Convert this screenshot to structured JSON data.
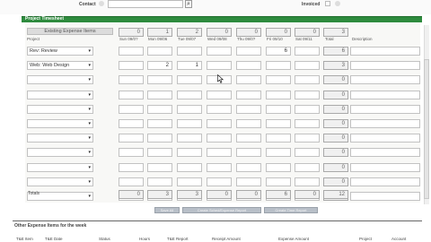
{
  "contact": {
    "label": "Contact",
    "value": ""
  },
  "invoiced": {
    "label": "Invoiced"
  },
  "section": {
    "title": "Project Timesheet"
  },
  "table": {
    "existing_label": "Existing Expense Items",
    "project_header": "Project",
    "day_headers": [
      "Sun 09/0?",
      "Mon 09/06",
      "Tue 09/07",
      "Wed 09/08",
      "Thu 09/0?",
      "Fri 09/10",
      "Sat 09/11"
    ],
    "total_header": "Total",
    "description_header": "Description",
    "existing_cells": [
      "0",
      "1",
      "2",
      "0",
      "0",
      "0",
      "0",
      "3"
    ],
    "rows": [
      {
        "project": "Rev: Review",
        "cells": [
          "",
          "",
          "",
          "",
          "",
          "6",
          ""
        ],
        "total": "6"
      },
      {
        "project": "Web: Web Design",
        "cells": [
          "",
          "2",
          "1",
          "",
          "",
          "",
          ""
        ],
        "total": "3"
      },
      {
        "project": "",
        "cells": [
          "",
          "",
          "",
          "",
          "",
          "",
          ""
        ],
        "total": "0"
      },
      {
        "project": "",
        "cells": [
          "",
          "",
          "",
          "",
          "",
          "",
          ""
        ],
        "total": "0"
      },
      {
        "project": "",
        "cells": [
          "",
          "",
          "",
          "",
          "",
          "",
          ""
        ],
        "total": "0"
      },
      {
        "project": "",
        "cells": [
          "",
          "",
          "",
          "",
          "",
          "",
          ""
        ],
        "total": "0"
      },
      {
        "project": "",
        "cells": [
          "",
          "",
          "",
          "",
          "",
          "",
          ""
        ],
        "total": "0"
      },
      {
        "project": "",
        "cells": [
          "",
          "",
          "",
          "",
          "",
          "",
          ""
        ],
        "total": "0"
      },
      {
        "project": "",
        "cells": [
          "",
          "",
          "",
          "",
          "",
          "",
          ""
        ],
        "total": "0"
      },
      {
        "project": "",
        "cells": [
          "",
          "",
          "",
          "",
          "",
          "",
          ""
        ],
        "total": "0"
      },
      {
        "project": "",
        "cells": [
          "",
          "",
          "",
          "",
          "",
          "",
          ""
        ],
        "total": "0"
      }
    ],
    "totals_label": "Totals",
    "totals": [
      "0",
      "3",
      "3",
      "0",
      "0",
      "6",
      "0",
      "12"
    ]
  },
  "buttons": {
    "save_all": "Save All",
    "create_expense": "Create Sched/Expense Report",
    "create_time": "Create Time Report"
  },
  "lower": {
    "title": "Other Expense Items for the week",
    "headers": [
      "T&E Item",
      "T&E Date",
      "Status",
      "Hours",
      "T&E Report",
      "Receipt Amount",
      "Expense Amount",
      "Project",
      "Account"
    ]
  },
  "colors": {
    "section_bar": "#2e8b3e",
    "button": "#b8bfc8"
  },
  "icons": {
    "lookup": "search-icon",
    "cursor": "mouse-pointer-icon"
  }
}
